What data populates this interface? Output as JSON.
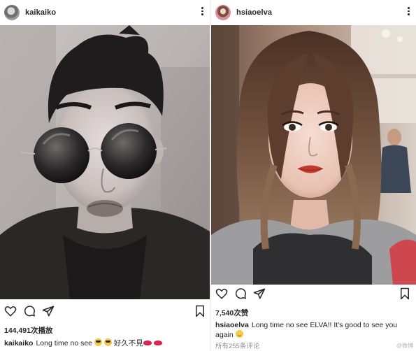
{
  "left_post": {
    "username": "kaikaiko",
    "views": "144,491次播放",
    "caption": {
      "username": "kaikaiko",
      "text": "Long time no see",
      "text_after": "好久不見"
    },
    "icons": [
      "heart-icon",
      "comment-icon",
      "share-icon",
      "bookmark-icon",
      "more-icon"
    ]
  },
  "right_post": {
    "username": "hsiaoelva",
    "likes": "7,540次赞",
    "caption": {
      "username": "hsiaoelva",
      "text": "Long time no see ELVA!! It's good to see you again"
    },
    "comments_link": "所有255条评论",
    "icons": [
      "heart-icon",
      "comment-icon",
      "share-icon",
      "bookmark-icon",
      "more-icon"
    ]
  },
  "watermark": "@微博",
  "colors": {
    "text": "#262626",
    "muted": "#8e8e8e",
    "lipstick": "#e0244f",
    "emoji": "#f7c948"
  }
}
